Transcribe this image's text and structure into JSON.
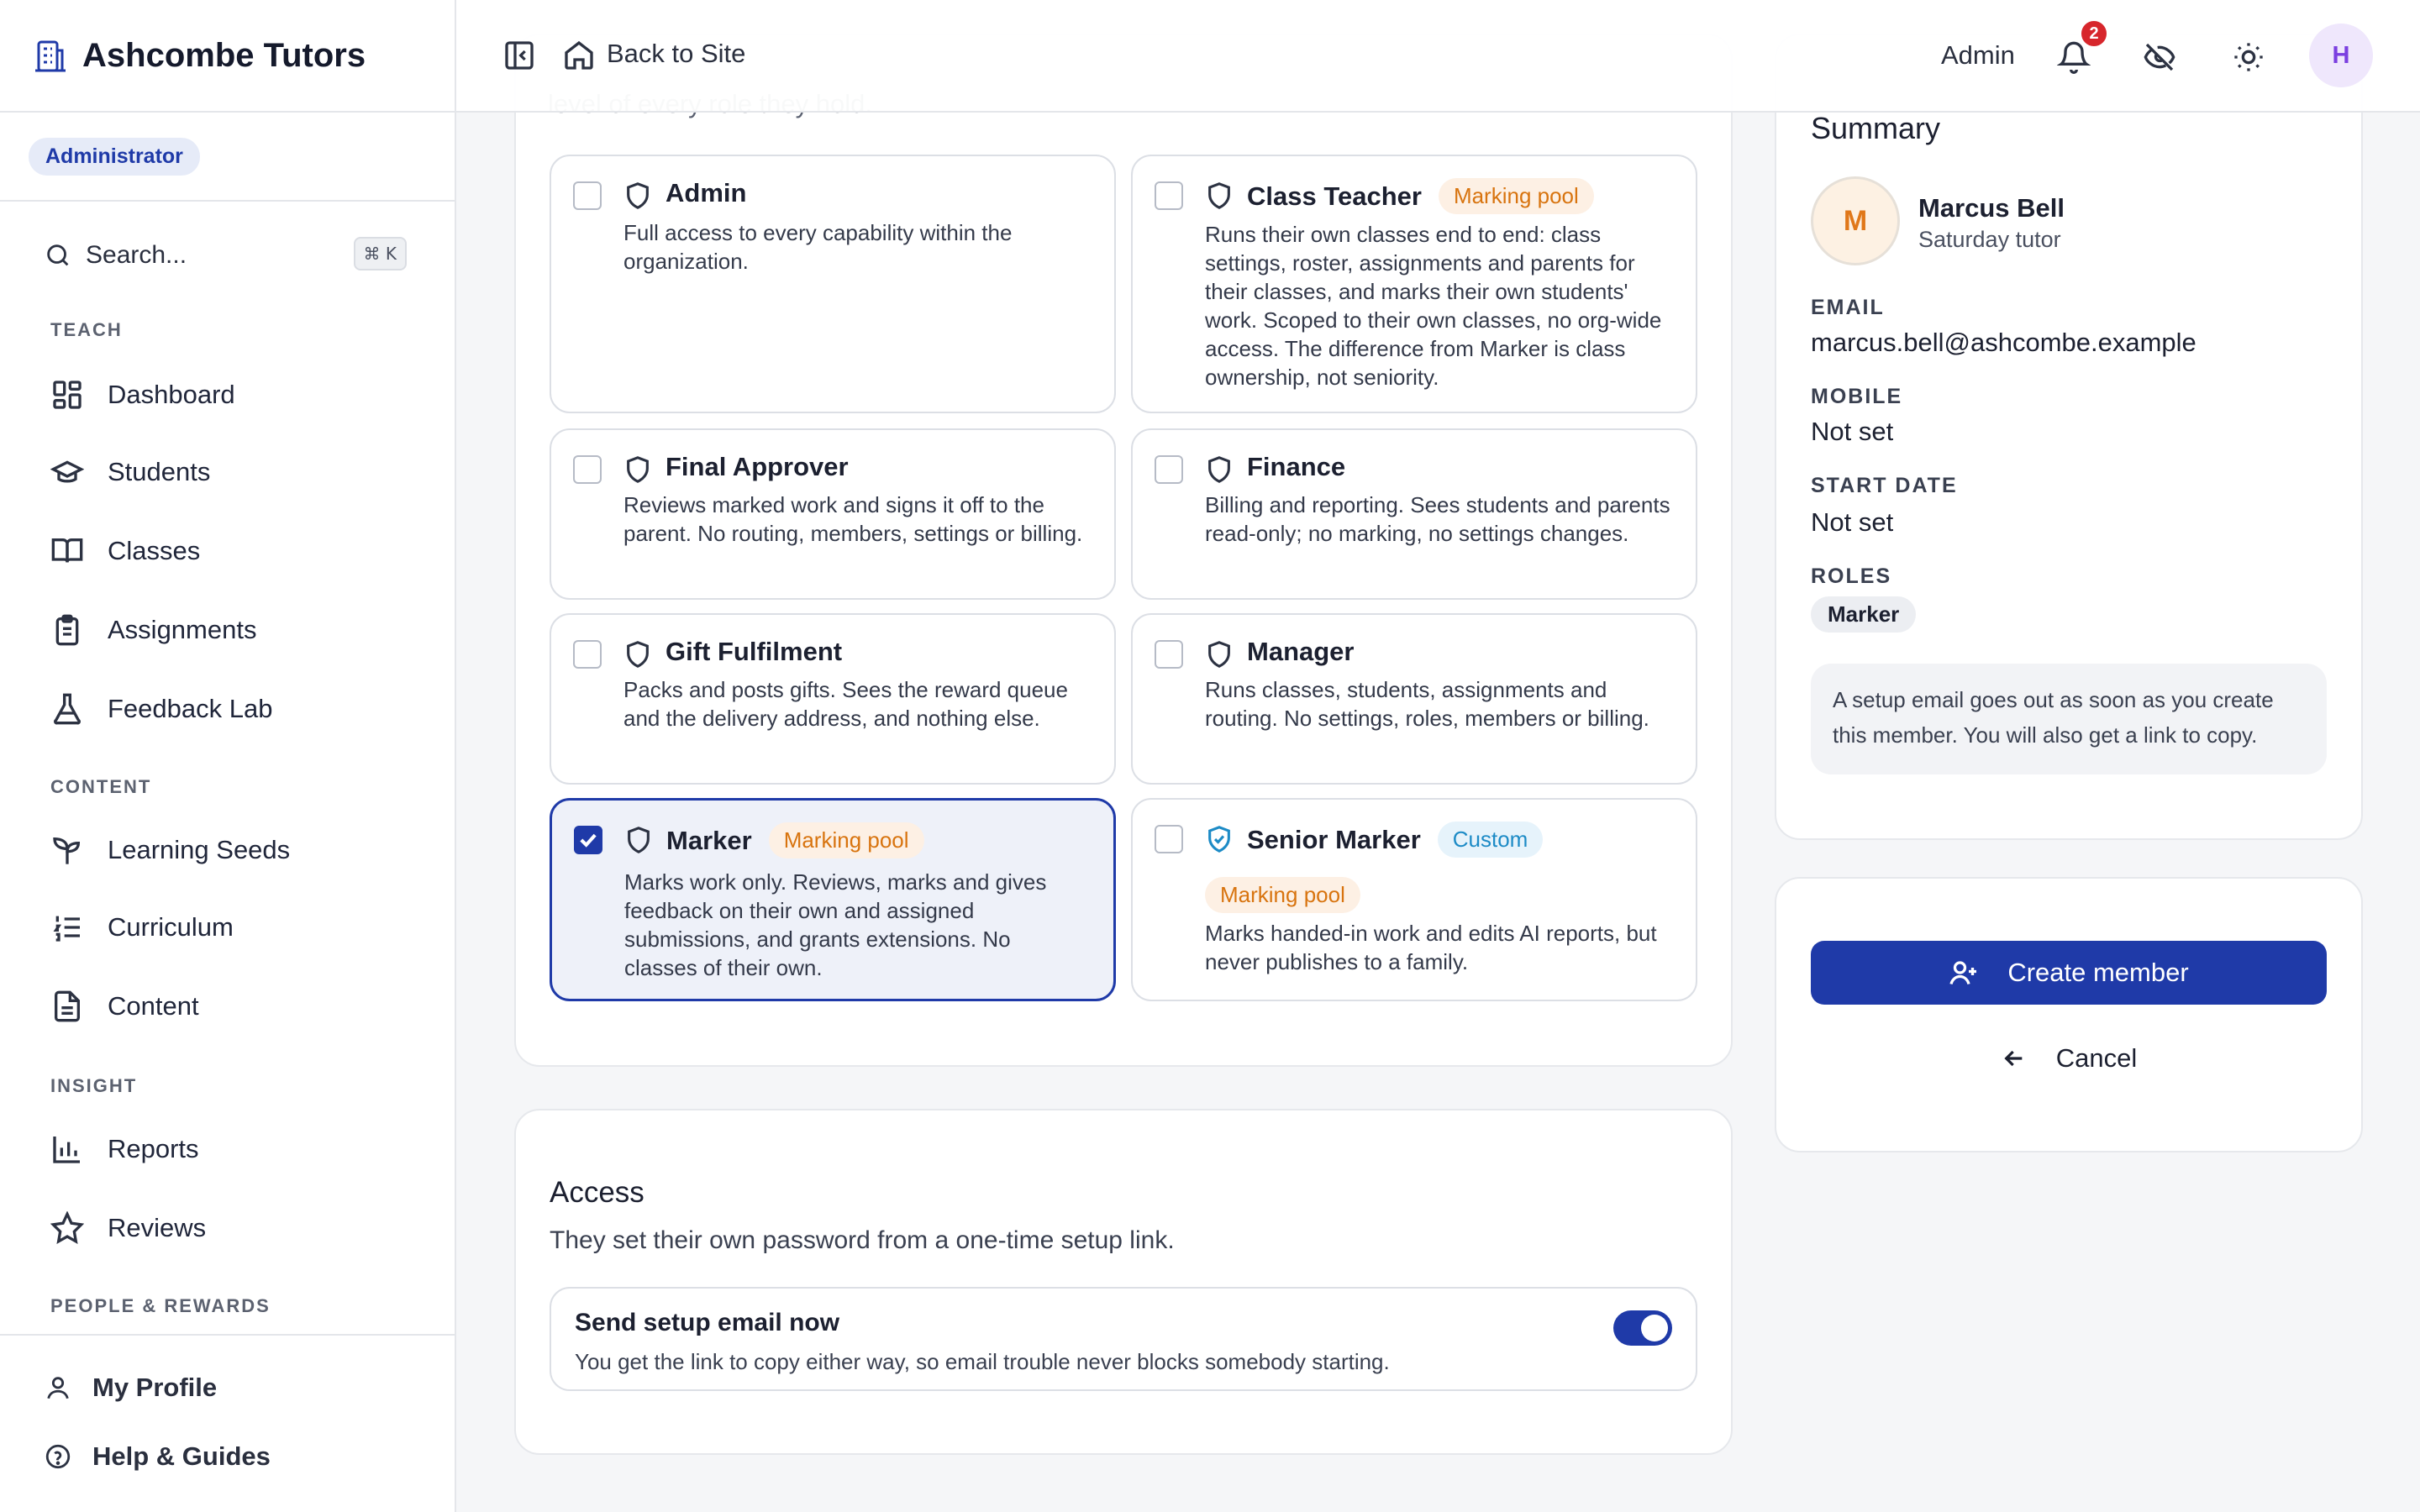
{
  "brand": {
    "name": "Ashcombe Tutors"
  },
  "sidebar": {
    "role_badge": "Administrator",
    "search_placeholder": "Search...",
    "search_shortcut": "⌘ K",
    "sections": {
      "teach": "TEACH",
      "content": "CONTENT",
      "insight": "INSIGHT",
      "people": "PEOPLE & REWARDS"
    },
    "items": {
      "dashboard": "Dashboard",
      "students": "Students",
      "classes": "Classes",
      "assignments": "Assignments",
      "feedback_lab": "Feedback Lab",
      "learning_seeds": "Learning Seeds",
      "curriculum": "Curriculum",
      "content": "Content",
      "reports": "Reports",
      "reviews": "Reviews"
    },
    "footer": {
      "profile": "My Profile",
      "help": "Help & Guides"
    }
  },
  "topbar": {
    "back": "Back to Site",
    "user_label": "Admin",
    "notification_count": "2",
    "avatar_initial": "H"
  },
  "roles": {
    "cutoff_text": "level of every role they hold.",
    "pool_tag": "Marking pool",
    "custom_tag": "Custom",
    "items": [
      {
        "name": "Admin",
        "desc": "Full access to every capability within the organization.",
        "checked": false
      },
      {
        "name": "Class Teacher",
        "desc": "Runs their own classes end to end: class settings, roster, assignments and parents for their classes, and marks their own students' work. Scoped to their own classes, no org-wide access. The difference from Marker is class ownership, not seniority.",
        "checked": false
      },
      {
        "name": "Final Approver",
        "desc": "Reviews marked work and signs it off to the parent. No routing, members, settings or billing.",
        "checked": false
      },
      {
        "name": "Finance",
        "desc": "Billing and reporting. Sees students and parents read-only; no marking, no settings changes.",
        "checked": false
      },
      {
        "name": "Gift Fulfilment",
        "desc": "Packs and posts gifts. Sees the reward queue and the delivery address, and nothing else.",
        "checked": false
      },
      {
        "name": "Manager",
        "desc": "Runs classes, students, assignments and routing. No settings, roles, members or billing.",
        "checked": false
      },
      {
        "name": "Marker",
        "desc": "Marks work only. Reviews, marks and gives feedback on their own and assigned submissions, and grants extensions. No classes of their own.",
        "checked": true
      },
      {
        "name": "Senior Marker",
        "desc": "Marks handed-in work and edits AI reports, but never publishes to a family.",
        "checked": false
      }
    ]
  },
  "access": {
    "title": "Access",
    "subtitle": "They set their own password from a one-time setup link.",
    "setup_title": "Send setup email now",
    "setup_desc": "You get the link to copy either way, so email trouble never blocks somebody starting.",
    "setup_enabled": true
  },
  "summary": {
    "title": "Summary",
    "initial": "M",
    "name": "Marcus Bell",
    "role_desc": "Saturday tutor",
    "email_label": "EMAIL",
    "email": "marcus.bell@ashcombe.example",
    "mobile_label": "MOBILE",
    "mobile": "Not set",
    "start_label": "START DATE",
    "start": "Not set",
    "roles_label": "ROLES",
    "role_chip": "Marker",
    "note": "A setup email goes out as soon as you create this member. You will also get a link to copy."
  },
  "actions": {
    "create": "Create member",
    "cancel": "Cancel"
  },
  "colors": {
    "primary": "#1f3aa8",
    "pool": "#d8740f",
    "custom": "#1d8bc6",
    "badge": "#d7262c"
  }
}
